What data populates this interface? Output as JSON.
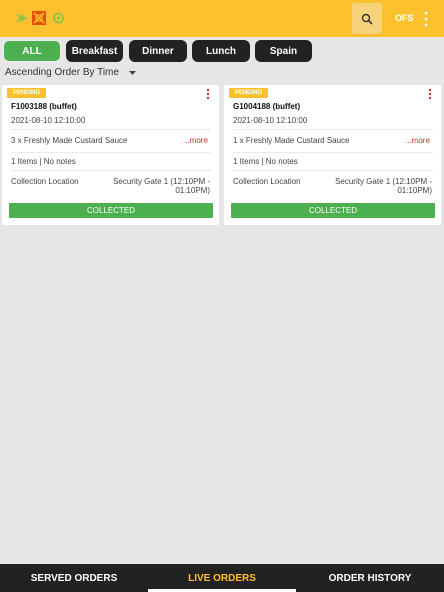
{
  "topbar": {
    "ofs_label": "OFS",
    "logos": [
      "sun-logo",
      "crest-logo",
      "leaf-logo"
    ]
  },
  "filters": [
    {
      "label": "ALL",
      "active": true
    },
    {
      "label": "Breakfast",
      "active": false
    },
    {
      "label": "Dinner",
      "active": false
    },
    {
      "label": "Lunch",
      "active": false
    },
    {
      "label": "Spain",
      "active": false
    }
  ],
  "sort": {
    "selected": "Ascending Order By Time"
  },
  "orders": [
    {
      "status": "PENDING",
      "order_id": "F1003188 (buffet)",
      "datetime": "2021-08-10 12:10:00",
      "item": "3 x Freshly Made Custard Sauce",
      "more_label": "...more",
      "summary": "1 Items | No notes",
      "collection_label": "Collection Location",
      "collection_value": "Security Gate 1 (12:10PM - 01:10PM)",
      "action_label": "COLLECTED"
    },
    {
      "status": "PENDING",
      "order_id": "G1004188 (buffet)",
      "datetime": "2021-08-10 12:10:00",
      "item": "1 x Freshly Made Custard Sauce",
      "more_label": "...more",
      "summary": "1 Items | No notes",
      "collection_label": "Collection Location",
      "collection_value": "Security Gate 1 (12:10PM - 01:10PM)",
      "action_label": "COLLECTED"
    }
  ],
  "bottom_tabs": [
    {
      "label": "SERVED ORDERS",
      "active": false
    },
    {
      "label": "LIVE ORDERS",
      "active": true
    },
    {
      "label": "ORDER HISTORY",
      "active": false
    }
  ],
  "colors": {
    "topbar": "#fdc02f",
    "active_chip": "#4caf50",
    "chip": "#222222",
    "pending_badge": "#fdc02f",
    "collected_button": "#4caf50",
    "more_link": "#c0392b",
    "active_tab": "#fdc02f"
  }
}
